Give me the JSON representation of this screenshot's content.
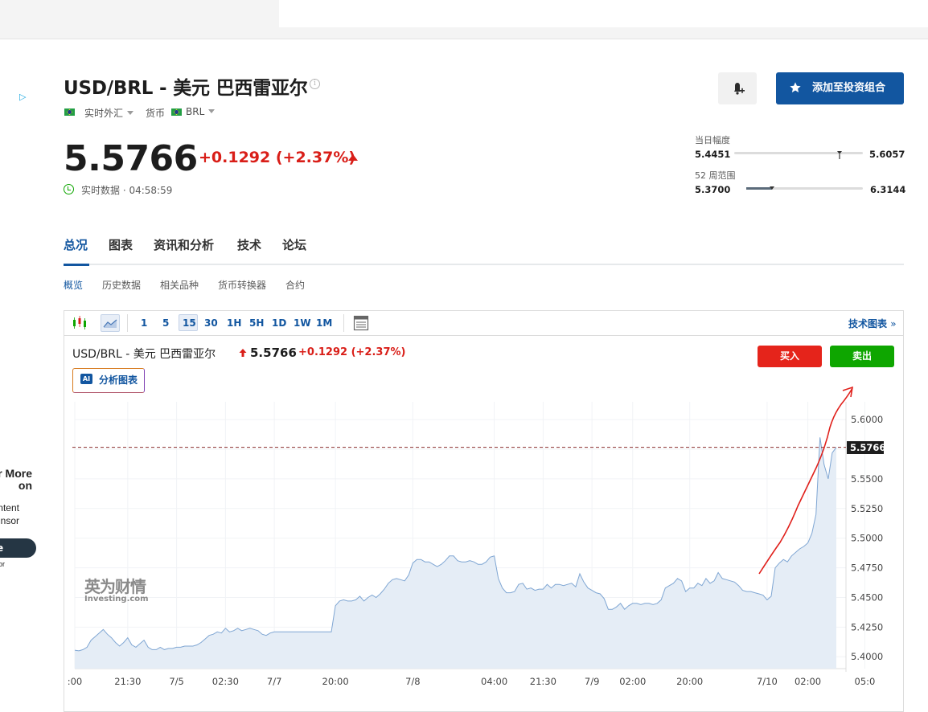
{
  "ad": {
    "choices_icon": "adchoices-icon",
    "title_line1": "r More",
    "title_line2": "on",
    "body_line1": "content",
    "body_line2": "nsor",
    "button_label": "e",
    "footer": "or"
  },
  "header": {
    "title": "USD/BRL - 美元 巴西雷亚尔",
    "info_icon": "info-icon",
    "market_label": "实时外汇",
    "type_label": "货币",
    "currency": "BRL",
    "alert_icon": "bell-plus-icon",
    "add_portfolio_label": "添加至投资组合"
  },
  "quote": {
    "price": "5.5766",
    "change": "+0.1292 (+2.37%)",
    "direction": "up",
    "realtime_label": "实时数据 · 04:58:59",
    "up_color": "#d91e18"
  },
  "ranges": {
    "day": {
      "label": "当日幅度",
      "low": "5.4451",
      "high": "5.6057",
      "position": 0.82
    },
    "week52": {
      "label": "52 周范围",
      "low": "5.3700",
      "high": "6.3144",
      "position": 0.22
    }
  },
  "tabs": [
    "总况",
    "图表",
    "资讯和分析",
    "技术",
    "论坛"
  ],
  "active_tab": "总况",
  "subtabs": [
    "概览",
    "历史数据",
    "相关品种",
    "货币转换器",
    "合约"
  ],
  "toolbar": {
    "timeframes": [
      "1",
      "5",
      "15",
      "30",
      "1H",
      "5H",
      "1D",
      "1W",
      "1M"
    ],
    "active_timeframe": "15",
    "tech_chart_label": "技术图表",
    "tech_chart_suffix": "»"
  },
  "chart_header": {
    "title": "USD/BRL - 美元 巴西雷亚尔",
    "price": "5.5766",
    "change": "+0.1292  (+2.37%)",
    "ai_badge": "AI",
    "ai_label": "分析图表",
    "buy_label": "买入",
    "sell_label": "卖出"
  },
  "watermark": {
    "cn": "英为财情",
    "en": "Investing.com"
  },
  "chart_data": {
    "type": "area",
    "title": "",
    "xlabel": "",
    "ylabel": "",
    "ylim": [
      5.39,
      5.615
    ],
    "yticks": [
      5.4,
      5.425,
      5.45,
      5.475,
      5.5,
      5.525,
      5.55,
      5.575,
      5.6
    ],
    "ytick_labels": [
      "5.4000",
      "5.4250",
      "5.4500",
      "5.4750",
      "5.5000",
      "5.5250",
      "5.5500",
      "5.5750",
      "5.6000"
    ],
    "xticks": [
      {
        "i": 0,
        "label": ":00"
      },
      {
        "i": 13,
        "label": "21:30"
      },
      {
        "i": 25,
        "label": "7/5"
      },
      {
        "i": 37,
        "label": "02:30"
      },
      {
        "i": 49,
        "label": "7/7"
      },
      {
        "i": 64,
        "label": "20:00"
      },
      {
        "i": 83,
        "label": "7/8"
      },
      {
        "i": 103,
        "label": "04:00"
      },
      {
        "i": 115,
        "label": "21:30"
      },
      {
        "i": 127,
        "label": "7/9"
      },
      {
        "i": 137,
        "label": "02:00"
      },
      {
        "i": 151,
        "label": "20:00"
      },
      {
        "i": 170,
        "label": "7/10"
      },
      {
        "i": 180,
        "label": "02:00"
      },
      {
        "i": 194,
        "label": "05:0"
      }
    ],
    "last_price": 5.5766,
    "last_price_label": "5.5766",
    "series": [
      {
        "values": [
          5.4055,
          5.405,
          5.406,
          5.408,
          5.414,
          5.417,
          5.42,
          5.423,
          5.419,
          5.416,
          5.412,
          5.409,
          5.412,
          5.416,
          5.41,
          5.408,
          5.411,
          5.414,
          5.408,
          5.406,
          5.406,
          5.408,
          5.406,
          5.407,
          5.407,
          5.408,
          5.408,
          5.409,
          5.409,
          5.409,
          5.41,
          5.412,
          5.415,
          5.418,
          5.419,
          5.421,
          5.42,
          5.424,
          5.421,
          5.422,
          5.424,
          5.422,
          5.423,
          5.424,
          5.423,
          5.422,
          5.419,
          5.418,
          5.42,
          5.421,
          5.421,
          5.421,
          5.421,
          5.421,
          5.421,
          5.421,
          5.421,
          5.421,
          5.421,
          5.421,
          5.421,
          5.421,
          5.421,
          5.421,
          5.443,
          5.447,
          5.448,
          5.447,
          5.447,
          5.448,
          5.451,
          5.447,
          5.45,
          5.452,
          5.45,
          5.453,
          5.457,
          5.462,
          5.465,
          5.466,
          5.465,
          5.464,
          5.469,
          5.479,
          5.482,
          5.482,
          5.48,
          5.48,
          5.478,
          5.476,
          5.478,
          5.481,
          5.485,
          5.485,
          5.481,
          5.48,
          5.48,
          5.481,
          5.48,
          5.478,
          5.478,
          5.48,
          5.484,
          5.485,
          5.466,
          5.458,
          5.454,
          5.454,
          5.455,
          5.461,
          5.462,
          5.457,
          5.458,
          5.456,
          5.457,
          5.457,
          5.461,
          5.458,
          5.461,
          5.461,
          5.46,
          5.461,
          5.462,
          5.459,
          5.47,
          5.463,
          5.458,
          5.456,
          5.454,
          5.453,
          5.449,
          5.44,
          5.44,
          5.442,
          5.445,
          5.44,
          5.443,
          5.445,
          5.445,
          5.444,
          5.445,
          5.445,
          5.444,
          5.445,
          5.448,
          5.458,
          5.46,
          5.462,
          5.466,
          5.464,
          5.455,
          5.458,
          5.458,
          5.462,
          5.46,
          5.466,
          5.462,
          5.464,
          5.471,
          5.466,
          5.465,
          5.464,
          5.463,
          5.46,
          5.456,
          5.455,
          5.455,
          5.454,
          5.453,
          5.452,
          5.448,
          5.451,
          5.475,
          5.479,
          5.482,
          5.48,
          5.485,
          5.488,
          5.491,
          5.493,
          5.496,
          5.504,
          5.52,
          5.585,
          5.562,
          5.55,
          5.572,
          5.5766
        ]
      }
    ]
  }
}
